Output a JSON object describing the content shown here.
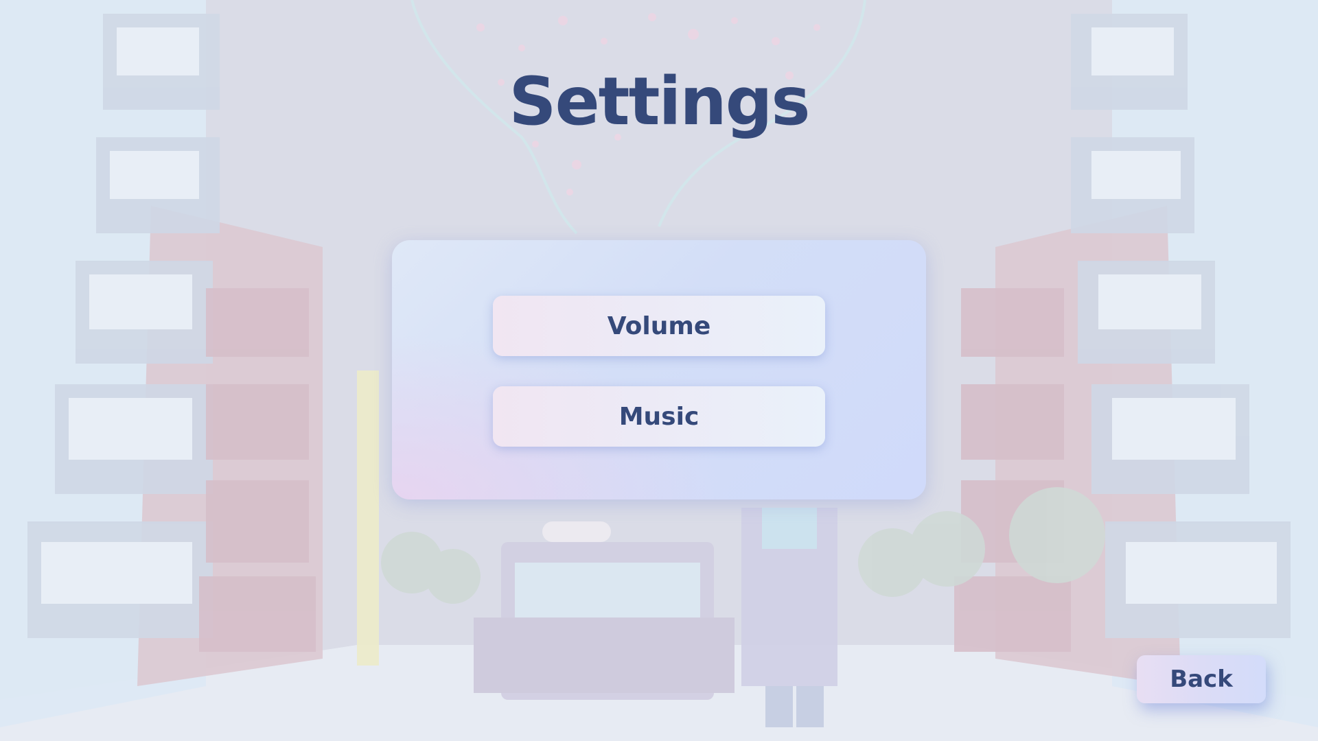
{
  "screen": {
    "title": "Settings"
  },
  "menu": {
    "items": [
      {
        "label": "Volume"
      },
      {
        "label": "Music"
      }
    ]
  },
  "footer": {
    "back_label": "Back"
  },
  "colors": {
    "title_text": "#35497a",
    "button_text": "#35497a",
    "panel_bg": "#d3def7",
    "backdrop": "#dcdfe9"
  }
}
